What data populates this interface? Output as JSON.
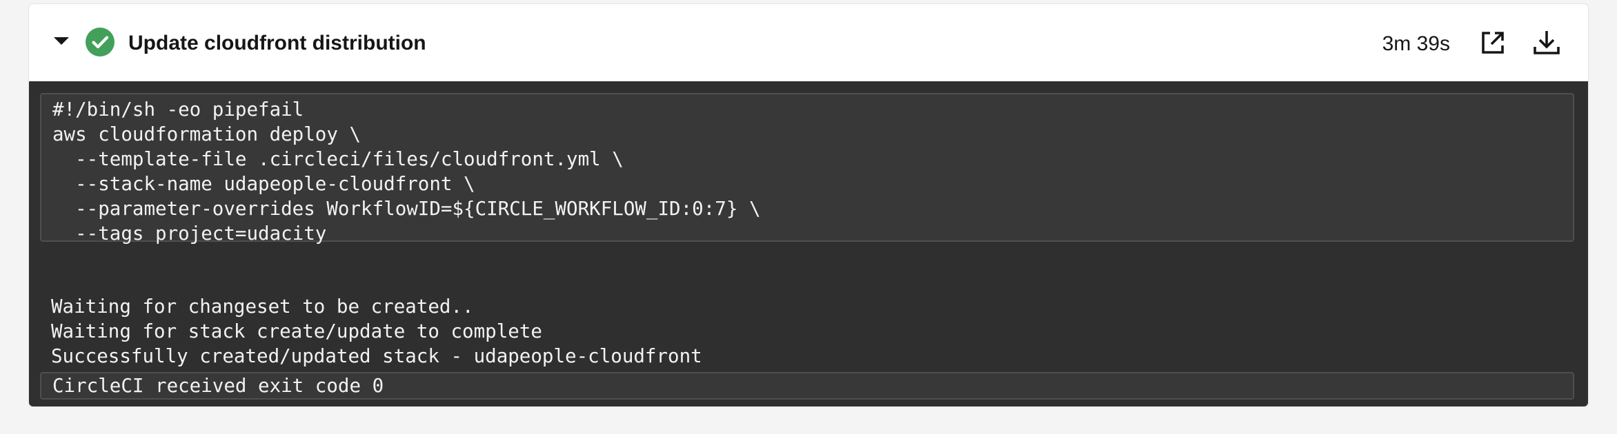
{
  "step": {
    "title": "Update cloudfront distribution",
    "duration": "3m 39s",
    "status": "success",
    "status_color": "#42a05a",
    "icons": {
      "collapse": "caret-down-icon",
      "status": "check-circle-icon",
      "open": "external-link-icon",
      "download": "download-icon"
    }
  },
  "command": {
    "lines": [
      "#!/bin/sh -eo pipefail",
      "aws cloudformation deploy \\",
      "  --template-file .circleci/files/cloudfront.yml \\",
      "  --stack-name udapeople-cloudfront \\",
      "  --parameter-overrides WorkflowID=${CIRCLE_WORKFLOW_ID:0:7} \\",
      "  --tags project=udacity"
    ]
  },
  "output": {
    "lines": [
      "Waiting for changeset to be created..",
      "Waiting for stack create/update to complete",
      "Successfully created/updated stack - udapeople-cloudfront"
    ]
  },
  "exit": {
    "message": "CircleCI received exit code 0"
  }
}
